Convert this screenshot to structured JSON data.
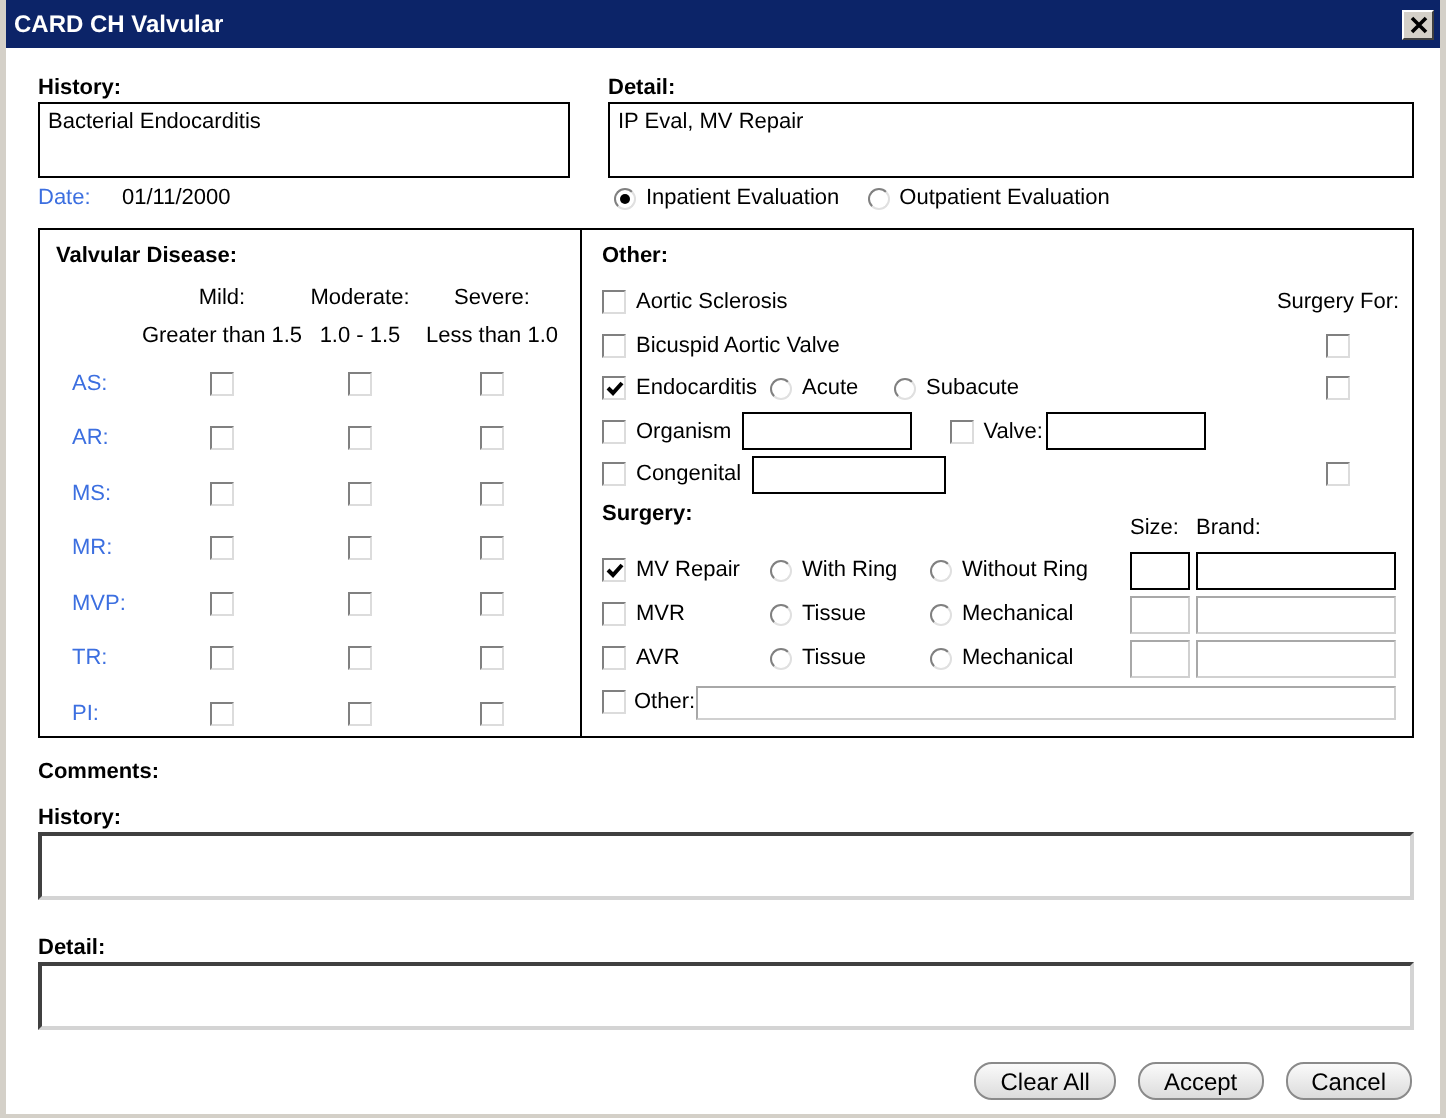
{
  "window": {
    "title": "CARD CH Valvular"
  },
  "history": {
    "label": "History:",
    "value": "Bacterial Endocarditis"
  },
  "detail": {
    "label": "Detail:",
    "value": "IP Eval, MV Repair"
  },
  "date": {
    "label": "Date:",
    "value": "01/11/2000"
  },
  "evaluation": [
    {
      "label": "Inpatient Evaluation",
      "selected": true
    },
    {
      "label": "Outpatient Evaluation",
      "selected": false
    }
  ],
  "valvular": {
    "title": "Valvular Disease:",
    "columns": [
      {
        "label": "Mild:",
        "range": "Greater than 1.5"
      },
      {
        "label": "Moderate:",
        "range": "1.0 - 1.5"
      },
      {
        "label": "Severe:",
        "range": "Less than 1.0"
      }
    ],
    "rows": [
      {
        "label": "AS:",
        "checks": [
          false,
          false,
          false
        ]
      },
      {
        "label": "AR:",
        "checks": [
          false,
          false,
          false
        ]
      },
      {
        "label": "MS:",
        "checks": [
          false,
          false,
          false
        ]
      },
      {
        "label": "MR:",
        "checks": [
          false,
          false,
          false
        ]
      },
      {
        "label": "MVP:",
        "checks": [
          false,
          false,
          false
        ]
      },
      {
        "label": "TR:",
        "checks": [
          false,
          false,
          false
        ]
      },
      {
        "label": "PI:",
        "checks": [
          false,
          false,
          false
        ]
      }
    ]
  },
  "other": {
    "title": "Other:",
    "surgery_for_label": "Surgery For:",
    "items": [
      {
        "kind": "plain",
        "label": "Aortic Sclerosis",
        "checked": false
      },
      {
        "kind": "plain",
        "label": "Bicuspid Aortic Valve",
        "checked": false,
        "surgery_for": false
      },
      {
        "kind": "radios",
        "label": "Endocarditis",
        "checked": true,
        "options": [
          {
            "label": "Acute",
            "selected": false
          },
          {
            "label": "Subacute",
            "selected": false
          }
        ],
        "surgery_for": false
      },
      {
        "kind": "field",
        "label": "Organism",
        "checked": false,
        "extra": {
          "label": "Valve:",
          "checked": false
        }
      },
      {
        "kind": "field",
        "label": "Congenital",
        "checked": false,
        "surgery_for": false
      }
    ]
  },
  "surgery": {
    "title": "Surgery:",
    "size_label": "Size:",
    "brand_label": "Brand:",
    "items": [
      {
        "kind": "options",
        "label": "MV Repair",
        "checked": true,
        "fields_enabled": true,
        "options": [
          {
            "label": "With Ring",
            "selected": false
          },
          {
            "label": "Without Ring",
            "selected": false
          }
        ]
      },
      {
        "kind": "options",
        "label": "MVR",
        "checked": false,
        "fields_enabled": false,
        "options": [
          {
            "label": "Tissue",
            "selected": false
          },
          {
            "label": "Mechanical",
            "selected": false
          }
        ]
      },
      {
        "kind": "options",
        "label": "AVR",
        "checked": false,
        "fields_enabled": false,
        "options": [
          {
            "label": "Tissue",
            "selected": false
          },
          {
            "label": "Mechanical",
            "selected": false
          }
        ]
      },
      {
        "kind": "other",
        "label": "Other:",
        "checked": false
      }
    ]
  },
  "comments": {
    "title": "Comments:",
    "history_label": "History:",
    "detail_label": "Detail:"
  },
  "buttons": [
    "Clear All",
    "Accept",
    "Cancel"
  ]
}
